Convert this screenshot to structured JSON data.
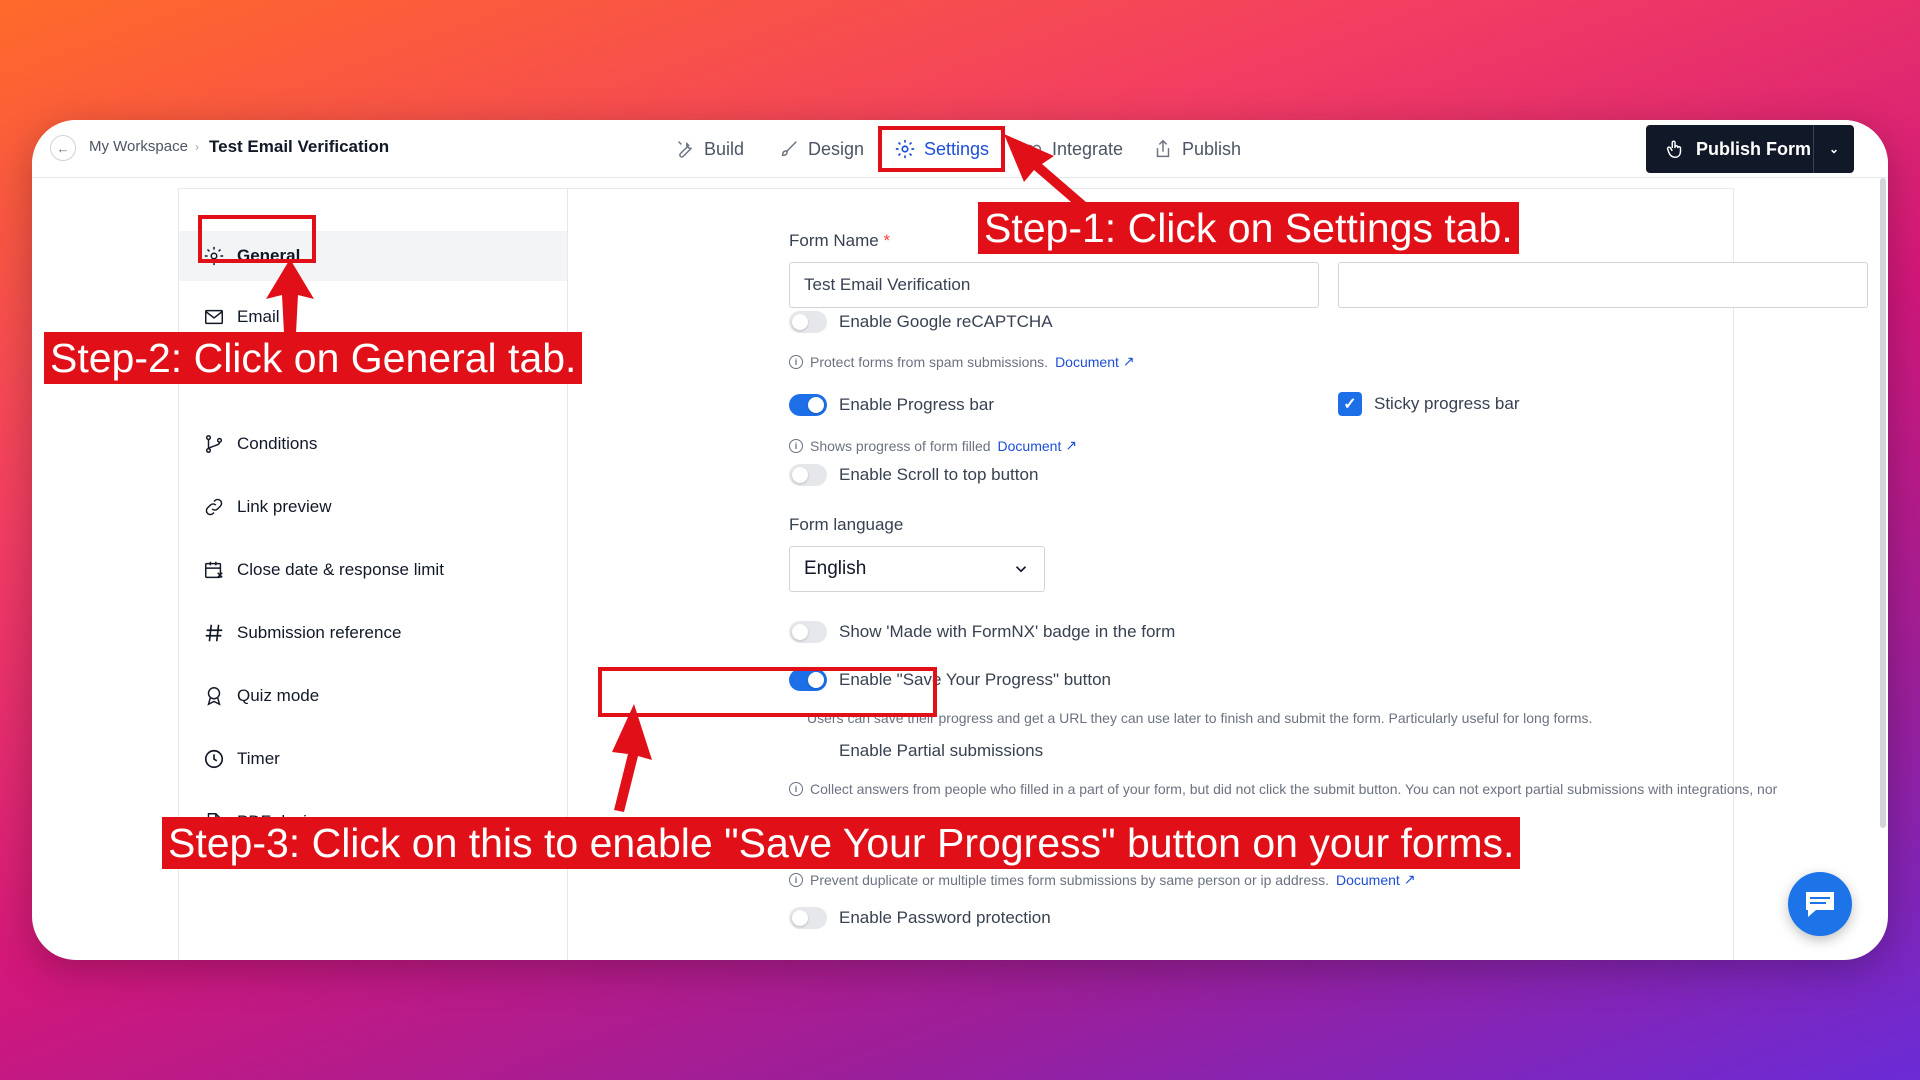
{
  "header": {
    "workspace": "My Workspace",
    "separator": "›",
    "form_title": "Test Email Verification",
    "tabs": [
      {
        "label": "Build",
        "icon": "wrench-icon"
      },
      {
        "label": "Design",
        "icon": "brush-icon"
      },
      {
        "label": "Settings",
        "icon": "gear-icon",
        "active": true
      },
      {
        "label": "Integrate",
        "icon": "plug-icon"
      },
      {
        "label": "Publish",
        "icon": "share-icon"
      }
    ],
    "publish_button": "Publish Form"
  },
  "sidebar": {
    "items": [
      {
        "label": "General",
        "icon": "gear-icon",
        "active": true
      },
      {
        "label": "Email",
        "icon": "mail-icon"
      },
      {
        "label": "Conditions",
        "icon": "branch-icon"
      },
      {
        "label": "Link preview",
        "icon": "link-icon"
      },
      {
        "label": "Close date & response limit",
        "icon": "calendar-x-icon"
      },
      {
        "label": "Submission reference",
        "icon": "hash-icon"
      },
      {
        "label": "Quiz mode",
        "icon": "award-icon"
      },
      {
        "label": "Timer",
        "icon": "clock-icon"
      },
      {
        "label": "PDF design",
        "icon": "document-icon"
      }
    ]
  },
  "general": {
    "form_name_label": "Form Name",
    "form_name_required": "*",
    "form_name_value": "Test Email Verification",
    "recaptcha_label": "Enable Google reCAPTCHA",
    "recaptcha_on": false,
    "recaptcha_hint": "Protect forms from spam submissions.",
    "document_link": "Document",
    "progress_bar_label": "Enable Progress bar",
    "progress_bar_on": true,
    "sticky_progress_label": "Sticky progress bar",
    "sticky_progress_checked": true,
    "progress_hint": "Shows progress of form filled",
    "scroll_top_label": "Enable Scroll to top button",
    "scroll_top_on": false,
    "language_label": "Form language",
    "language_value": "English",
    "badge_label": "Show 'Made with FormNX' badge in the form",
    "badge_on": false,
    "save_progress_label": "Enable \"Save Your Progress\" button",
    "save_progress_on": true,
    "save_progress_hint": "Users can save their progress and get a URL they can use later to finish and submit the form. Particularly useful for long forms.",
    "partial_label": "Enable Partial submissions",
    "partial_hint": "Collect answers from people who filled in a part of your form, but did not click the submit button. You can not export partial submissions with integrations, nor",
    "duplicate_hint": "Prevent duplicate or multiple times form submissions by same person or ip address.",
    "password_label": "Enable Password protection",
    "password_on": false
  },
  "annotations": {
    "step1": "Step-1: Click on Settings tab.",
    "step2": "Step-2: Click on General tab.",
    "step3": "Step-3: Click on this to enable \"Save Your Progress\" button on your forms."
  },
  "colors": {
    "accent": "#1d6fe8",
    "callout": "#e10f17",
    "publish_bg": "#111827"
  }
}
